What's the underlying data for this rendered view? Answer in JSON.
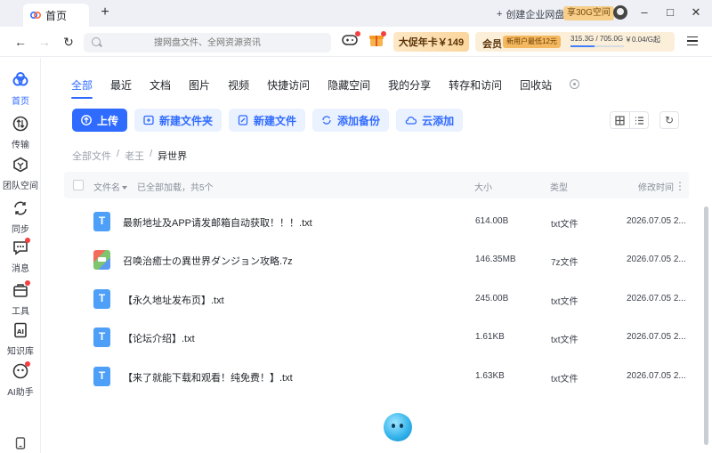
{
  "browser": {
    "tab_title": "首页",
    "enterprise_label": "创建企业网盘",
    "promo_badge": "享30G空间",
    "window_controls": [
      "–",
      "□",
      "✕"
    ]
  },
  "navbar": {
    "search_placeholder": "搜网盘文件、全网资源资讯",
    "promo_card": "大促年卡￥149",
    "vip_label": "会员",
    "vip_badge": "新用户最低12元",
    "storage_text": "315.3G / 705.0G",
    "storage_used_fraction": 0.447,
    "storage_price": "￥0.04/G起"
  },
  "sidebar": {
    "items": [
      {
        "label": "首页",
        "icon": "home-icon",
        "active": true
      },
      {
        "label": "传输",
        "icon": "transfer-icon"
      },
      {
        "label": "团队空间",
        "icon": "team-icon"
      },
      {
        "label": "同步",
        "icon": "sync-icon"
      },
      {
        "label": "消息",
        "icon": "message-icon"
      },
      {
        "label": "工具",
        "icon": "toolbox-icon"
      },
      {
        "label": "知识库",
        "icon": "knowledge-icon"
      },
      {
        "label": "AI助手",
        "icon": "ai-assistant-icon"
      }
    ]
  },
  "categories": [
    "全部",
    "最近",
    "文档",
    "图片",
    "视频",
    "快捷访问",
    "隐藏空间",
    "我的分享",
    "转存和访问",
    "回收站"
  ],
  "actions": {
    "upload": "上传",
    "new_folder": "新建文件夹",
    "new_file": "新建文件",
    "add_backup": "添加备份",
    "cloud_add": "云添加"
  },
  "breadcrumb": [
    "全部文件",
    "老王",
    "异世界"
  ],
  "table": {
    "col_name": "文件名",
    "load_status": "已全部加载，共5个",
    "col_size": "大小",
    "col_type": "类型",
    "col_date": "修改时间",
    "rows": [
      {
        "name": "最新地址及APP请发邮箱自动获取！！！.txt",
        "size": "614.00B",
        "type": "txt文件",
        "date": "2026.07.05 2...",
        "icon": "txt"
      },
      {
        "name": "召唤治癒士の異世界ダンジョン攻略.7z",
        "size": "146.35MB",
        "type": "7z文件",
        "date": "2026.07.05 2...",
        "icon": "zip"
      },
      {
        "name": "【永久地址发布页】.txt",
        "size": "245.00B",
        "type": "txt文件",
        "date": "2026.07.05 2...",
        "icon": "txt"
      },
      {
        "name": "【论坛介绍】.txt",
        "size": "1.61KB",
        "type": "txt文件",
        "date": "2026.07.05 2...",
        "icon": "txt"
      },
      {
        "name": "【来了就能下载和观看！纯免费！】.txt",
        "size": "1.63KB",
        "type": "txt文件",
        "date": "2026.07.05 2...",
        "icon": "txt"
      }
    ]
  },
  "colors": {
    "accent": "#2f6bff",
    "accent_light": "#eaf1ff",
    "promo": "#fbd59c"
  }
}
